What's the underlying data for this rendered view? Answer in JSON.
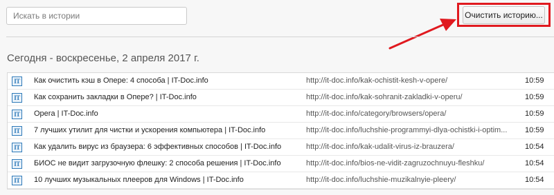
{
  "search": {
    "placeholder": "Искать в истории",
    "value": ""
  },
  "toolbar": {
    "clear_label": "Очистить историю..."
  },
  "annotation": {
    "highlight_color": "#e0191f",
    "arrow_color": "#e0191f"
  },
  "history": {
    "date_heading": "Сегодня - воскресенье, 2 апреля 2017 г.",
    "favicon_text": "IT",
    "items": [
      {
        "title": "Как очистить кэш в Опере: 4 способа | IT-Doc.info",
        "url": "http://it-doc.info/kak-ochistit-kesh-v-opere/",
        "time": "10:59"
      },
      {
        "title": "Как сохранить закладки в Опере? | IT-Doc.info",
        "url": "http://it-doc.info/kak-sohranit-zakladki-v-operu/",
        "time": "10:59"
      },
      {
        "title": "Opera | IT-Doc.info",
        "url": "http://it-doc.info/category/browsers/opera/",
        "time": "10:59"
      },
      {
        "title": "7 лучших утилит для чистки и ускорения компьютера | IT-Doc.info",
        "url": "http://it-doc.info/luchshie-programmyi-dlya-ochistki-i-optim...",
        "time": "10:59"
      },
      {
        "title": "Как удалить вирус из браузера: 6 эффективных способов | IT-Doc.info",
        "url": "http://it-doc.info/kak-udalit-virus-iz-brauzera/",
        "time": "10:54"
      },
      {
        "title": "БИОС не видит загрузочную флешку: 2 способа решения | IT-Doc.info",
        "url": "http://it-doc.info/bios-ne-vidit-zagruzochnuyu-fleshku/",
        "time": "10:54"
      },
      {
        "title": "10 лучших музыкальных плееров для Windows | IT-Doc.info",
        "url": "http://it-doc.info/luchshie-muzikalnyie-pleery/",
        "time": "10:54"
      }
    ]
  }
}
